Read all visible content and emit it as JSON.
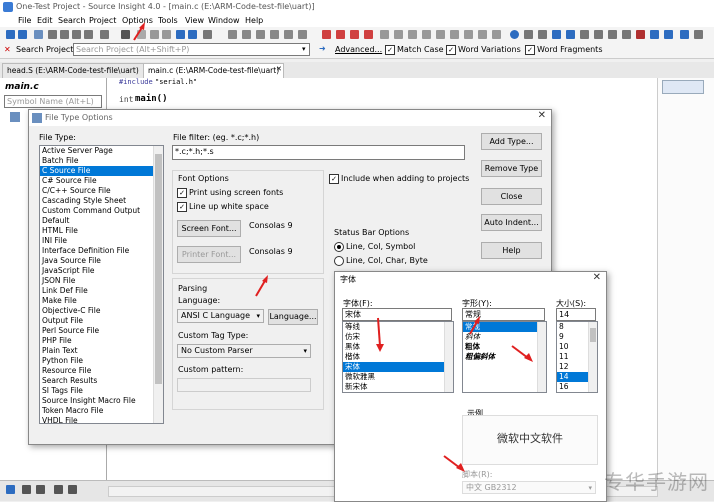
{
  "window": {
    "title": "One-Test Project - Source Insight 4.0 - [main.c (E:\\ARM-Code-test-file\\uart)]"
  },
  "menu": [
    "File",
    "Edit",
    "Search",
    "Project",
    "Options",
    "Tools",
    "View",
    "Window",
    "Help"
  ],
  "search": {
    "label": "Search Project:",
    "placeholder": "Search Project (Alt+Shift+P)",
    "advanced": "Advanced...",
    "match_case": "Match Case",
    "word_variations": "Word Variations",
    "word_fragments": "Word Fragments"
  },
  "tabs": [
    "head.S (E:\\ARM-Code-test-file\\uart)",
    "main.c (E:\\ARM-Code-test-file\\uart)"
  ],
  "left_panel": {
    "title": "main.c",
    "symbol_placeholder": "Symbol Name (Alt+L)"
  },
  "editor": {
    "line1_directive": "#include",
    "line1_arg": "\"serial.h\"",
    "line2_type": "int",
    "line2_name": "main()"
  },
  "file_type_dialog": {
    "title": "File Type Options",
    "file_type_label": "File Type:",
    "file_types": [
      "Active Server Page",
      "Batch File",
      "C Source File",
      "C# Source File",
      "C/C++ Source File",
      "Cascading Style Sheet",
      "Custom Command Output",
      "Default",
      "HTML File",
      "INI File",
      "Interface Definition File",
      "Java Source File",
      "JavaScript File",
      "JSON File",
      "Link Def File",
      "Make File",
      "Objective-C File",
      "Output File",
      "Perl Source File",
      "PHP File",
      "Plain Text",
      "Python File",
      "Resource File",
      "Search Results",
      "SI Tags File",
      "Source Insight Macro File",
      "Token Macro File",
      "VHDL File"
    ],
    "selected_index": 2,
    "filter_label": "File filter: (eg. *.c;*.h)",
    "filter_value": "*.c;*.h;*.s",
    "buttons": {
      "add": "Add Type...",
      "remove": "Remove Type",
      "close": "Close",
      "auto_indent": "Auto Indent...",
      "help": "Help"
    },
    "font_options": "Font Options",
    "print_screen_fonts": "Print using screen fonts",
    "line_up_whitespace": "Line up white space",
    "screen_font_btn": "Screen Font...",
    "screen_font_val": "Consolas 9",
    "printer_font_btn": "Printer Font...",
    "printer_font_val": "Consolas 9",
    "include_projects": "Include when adding to projects",
    "status_bar_options": "Status Bar Options",
    "status_opt1": "Line, Col, Symbol",
    "status_opt2": "Line, Col, Char, Byte",
    "parsing": "Parsing",
    "language_label": "Language:",
    "language_value": "ANSI C Language",
    "language_btn": "Language...",
    "custom_tag_label": "Custom Tag Type:",
    "custom_tag_value": "No Custom Parser",
    "custom_pattern_label": "Custom pattern:"
  },
  "font_dialog": {
    "title": "字体",
    "font_label": "字体(F):",
    "font_value": "宋体",
    "fonts": [
      "等线",
      "仿宋",
      "黑体",
      "楷体",
      "宋体",
      "微软雅黑",
      "新宋体"
    ],
    "font_sel": 4,
    "style_label": "字形(Y):",
    "style_value": "常规",
    "styles": [
      "常规",
      "斜体",
      "粗体",
      "粗偏斜体"
    ],
    "style_sel": 0,
    "size_label": "大小(S):",
    "size_value": "14",
    "sizes": [
      "8",
      "9",
      "10",
      "11",
      "12",
      "14",
      "16"
    ],
    "size_sel": 5,
    "sample_label": "示例",
    "sample_text": "微软中文软件",
    "script_label": "脚本(R):",
    "script_value": "中文 GB2312"
  },
  "watermark": "专华手游网",
  "colors": {
    "accent": "#0078d7",
    "arrow": "#e02020"
  }
}
